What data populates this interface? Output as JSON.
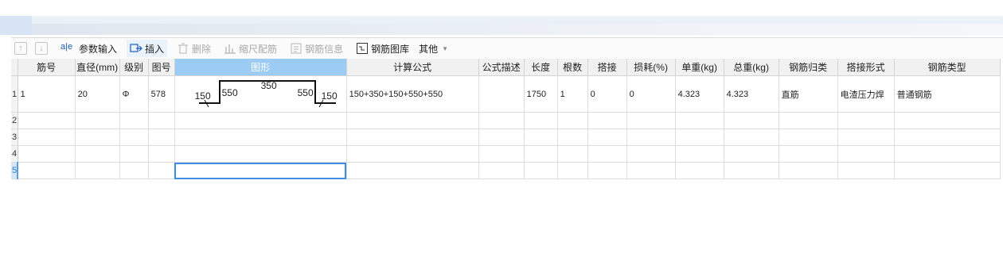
{
  "toolbar": {
    "param_input": "参数输入",
    "insert": "插入",
    "delete": "删除",
    "scale_rebar": "缩尺配筋",
    "rebar_info": "钢筋信息",
    "rebar_library": "钢筋图库",
    "other": "其他"
  },
  "columns": [
    "筋号",
    "直径(mm)",
    "级别",
    "图号",
    "图形",
    "计算公式",
    "公式描述",
    "长度",
    "根数",
    "搭接",
    "损耗(%)",
    "单重(kg)",
    "总重(kg)",
    "钢筋归类",
    "搭接形式",
    "钢筋类型"
  ],
  "rows": [
    {
      "row_no": "1",
      "bar_no": "1",
      "diameter": "20",
      "grade": "Φ",
      "figure_no": "578",
      "shape": {
        "left_end": "150",
        "left_rise": "550",
        "top": "350",
        "right_rise": "550",
        "right_end": "150"
      },
      "formula": "150+350+150+550+550",
      "formula_desc": "",
      "length": "1750",
      "count": "1",
      "lap": "0",
      "loss": "0",
      "unit_weight": "4.323",
      "total_weight": "4.323",
      "category": "直筋",
      "lap_type": "电渣压力焊",
      "rebar_type": "普通钢筋"
    }
  ],
  "empty_rows": [
    "2",
    "3",
    "4",
    "5"
  ],
  "colors": {
    "selected_header": "#9ccbf3",
    "focus_border": "#3d8ee0",
    "active_row_number": "#2f7fd0"
  }
}
